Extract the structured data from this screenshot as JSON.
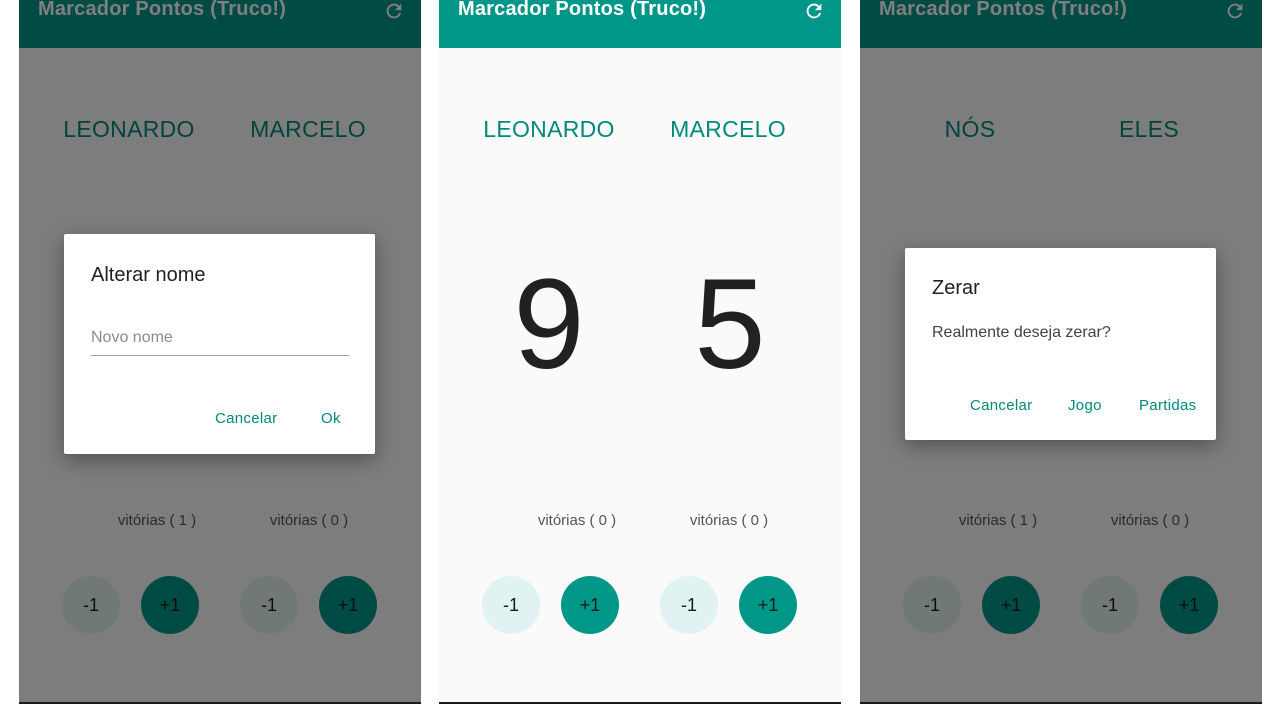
{
  "colors": {
    "primary": "#009688",
    "accent": "#00897b",
    "light_button": "#e0f2f1",
    "scrim": "rgba(0,0,0,0.5)"
  },
  "screens": [
    {
      "app_title": "Marcador Pontos (Truco!)",
      "refresh_icon": "refresh-icon",
      "team_a": {
        "name": "LEONARDO",
        "wins": "vitórias ( 1 )"
      },
      "team_b": {
        "name": "MARCELO",
        "wins": "vitórias ( 0 )"
      },
      "minus_label": "-1",
      "plus_label": "+1",
      "dialog": {
        "title": "Alterar nome",
        "input_placeholder": "Novo nome",
        "input_value": "",
        "cancel": "Cancelar",
        "ok": "Ok"
      }
    },
    {
      "app_title": "Marcador Pontos (Truco!)",
      "refresh_icon": "refresh-icon",
      "team_a": {
        "name": "LEONARDO",
        "score": "9",
        "wins": "vitórias ( 0 )"
      },
      "team_b": {
        "name": "MARCELO",
        "score": "5",
        "wins": "vitórias ( 0 )"
      },
      "minus_label": "-1",
      "plus_label": "+1"
    },
    {
      "app_title": "Marcador Pontos (Truco!)",
      "refresh_icon": "refresh-icon",
      "team_a": {
        "name": "NÓS",
        "wins": "vitórias ( 1 )"
      },
      "team_b": {
        "name": "ELES",
        "wins": "vitórias ( 0 )"
      },
      "minus_label": "-1",
      "plus_label": "+1",
      "dialog": {
        "title": "Zerar",
        "message": "Realmente deseja zerar?",
        "cancel": "Cancelar",
        "game": "Jogo",
        "matches": "Partidas"
      }
    }
  ]
}
